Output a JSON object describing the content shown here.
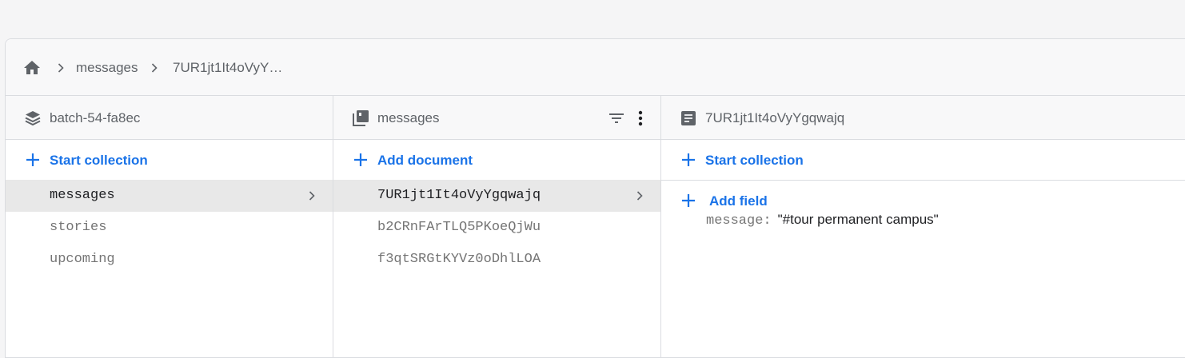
{
  "breadcrumb": {
    "home_icon": "home-icon",
    "items": [
      "messages",
      "7UR1jt1It4oVyY…"
    ]
  },
  "columns": {
    "root": {
      "header_icon": "database-stack-icon",
      "title": "batch-54-fa8ec",
      "action_label": "Start collection",
      "items": [
        {
          "label": "messages",
          "selected": true
        },
        {
          "label": "stories",
          "selected": false
        },
        {
          "label": "upcoming",
          "selected": false
        }
      ]
    },
    "collection": {
      "header_icon": "collection-icon",
      "title": "messages",
      "filter_icon": "filter-icon",
      "more_icon": "more-vert-icon",
      "action_label": "Add document",
      "items": [
        {
          "label": "7UR1jt1It4oVyYgqwajq",
          "selected": true
        },
        {
          "label": "b2CRnFArTLQ5PKoeQjWu",
          "selected": false
        },
        {
          "label": "f3qtSRGtKYVz0oDhlLOA",
          "selected": false
        }
      ]
    },
    "document": {
      "header_icon": "document-icon",
      "title": "7UR1jt1It4oVyYgqwajq",
      "start_collection_label": "Start collection",
      "add_field_label": "Add field",
      "fields": [
        {
          "key": "message:",
          "value": "\"#tour permanent campus\""
        }
      ]
    }
  },
  "colors": {
    "accent": "#1a73e8",
    "text_muted": "#5f6368",
    "selected_bg": "#e8e8e8",
    "border": "#dadce0"
  }
}
